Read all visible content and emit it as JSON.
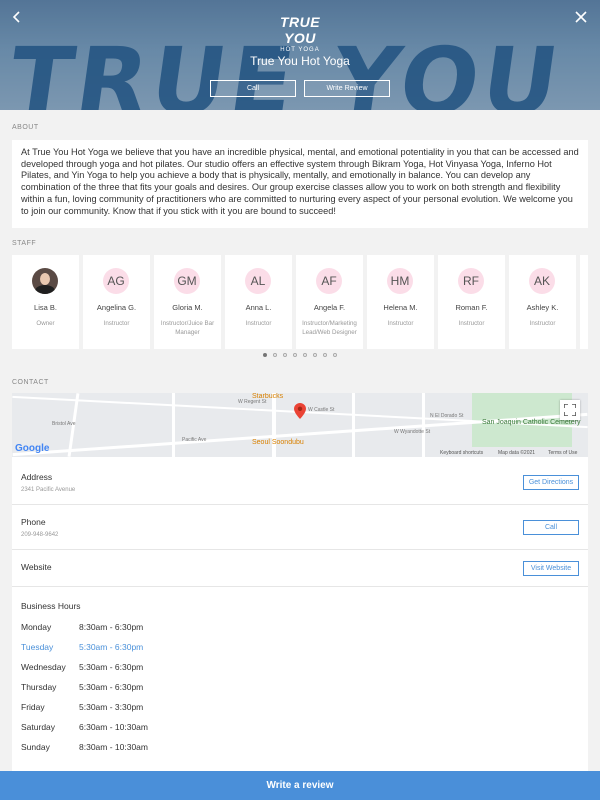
{
  "header": {
    "logo_main": "TRUE YOU",
    "logo_sub": "HOT YOGA",
    "bg_text": "TRUE YOU",
    "studio_name": "True You Hot Yoga",
    "call_label": "Call",
    "review_label": "Write Review"
  },
  "about": {
    "title": "ABOUT",
    "text": "At True You Hot Yoga we believe that you have an incredible physical, mental, and emotional potentiality in you that can be accessed and developed through yoga and hot pilates. Our studio offers an effective system through Bikram Yoga, Hot Vinyasa Yoga, Inferno Hot Pilates, and Yin Yoga to help you achieve a body that is physically, mentally, and emotionally in balance. You can develop any combination of the three that fits your goals and desires. Our group exercise classes allow you to work on both strength and flexibility within a fun, loving community of practitioners who are committed to nurturing every aspect of your personal evolution. We welcome you to join our community. Know that if you stick with it you are bound to succeed!"
  },
  "staff": {
    "title": "STAFF",
    "members": [
      {
        "initials": "",
        "name": "Lisa B.",
        "role": "Owner"
      },
      {
        "initials": "AG",
        "name": "Angelina G.",
        "role": "Instructor"
      },
      {
        "initials": "GM",
        "name": "Gloria M.",
        "role": "Instructor/Juice Bar Manager"
      },
      {
        "initials": "AL",
        "name": "Anna L.",
        "role": "Instructor"
      },
      {
        "initials": "AF",
        "name": "Angela F.",
        "role": "Instructor/Marketing Lead/Web Designer"
      },
      {
        "initials": "HM",
        "name": "Helena M.",
        "role": "Instructor"
      },
      {
        "initials": "RF",
        "name": "Roman F.",
        "role": "Instructor"
      },
      {
        "initials": "AK",
        "name": "Ashley K.",
        "role": "Instructor"
      }
    ]
  },
  "contact": {
    "title": "CONTACT",
    "map": {
      "poi_1": "Starbucks",
      "poi_2": "Seoul Soondubu",
      "poi_3": "San Joaquin Catholic Cemetery",
      "street_1": "W Castle St",
      "street_2": "W Regent St",
      "street_3": "Pacific Ave",
      "street_4": "Bristol Ave",
      "street_5": "W Wyandotte St",
      "street_6": "N El Dorado St",
      "footer_1": "Keyboard shortcuts",
      "footer_2": "Map data ©2021",
      "footer_3": "Terms of Use",
      "google": "Google"
    },
    "address_label": "Address",
    "address_value": "2341 Pacific Avenue",
    "directions_label": "Get Directions",
    "phone_label": "Phone",
    "phone_value": "209-948-9642",
    "call_label": "Call",
    "website_label": "Website",
    "visit_label": "Visit Website",
    "hours_title": "Business Hours",
    "hours": [
      {
        "day": "Monday",
        "time": "8:30am - 6:30pm"
      },
      {
        "day": "Tuesday",
        "time": "5:30am - 6:30pm"
      },
      {
        "day": "Wednesday",
        "time": "5:30am - 6:30pm"
      },
      {
        "day": "Thursday",
        "time": "5:30am - 6:30pm"
      },
      {
        "day": "Friday",
        "time": "5:30am - 3:30pm"
      },
      {
        "day": "Saturday",
        "time": "6:30am - 10:30am"
      },
      {
        "day": "Sunday",
        "time": "8:30am - 10:30am"
      }
    ]
  },
  "footer": {
    "write_review_label": "Write a review"
  },
  "colors": {
    "accent": "#4a8fd9",
    "avatar_bg": "#fbdde8"
  }
}
